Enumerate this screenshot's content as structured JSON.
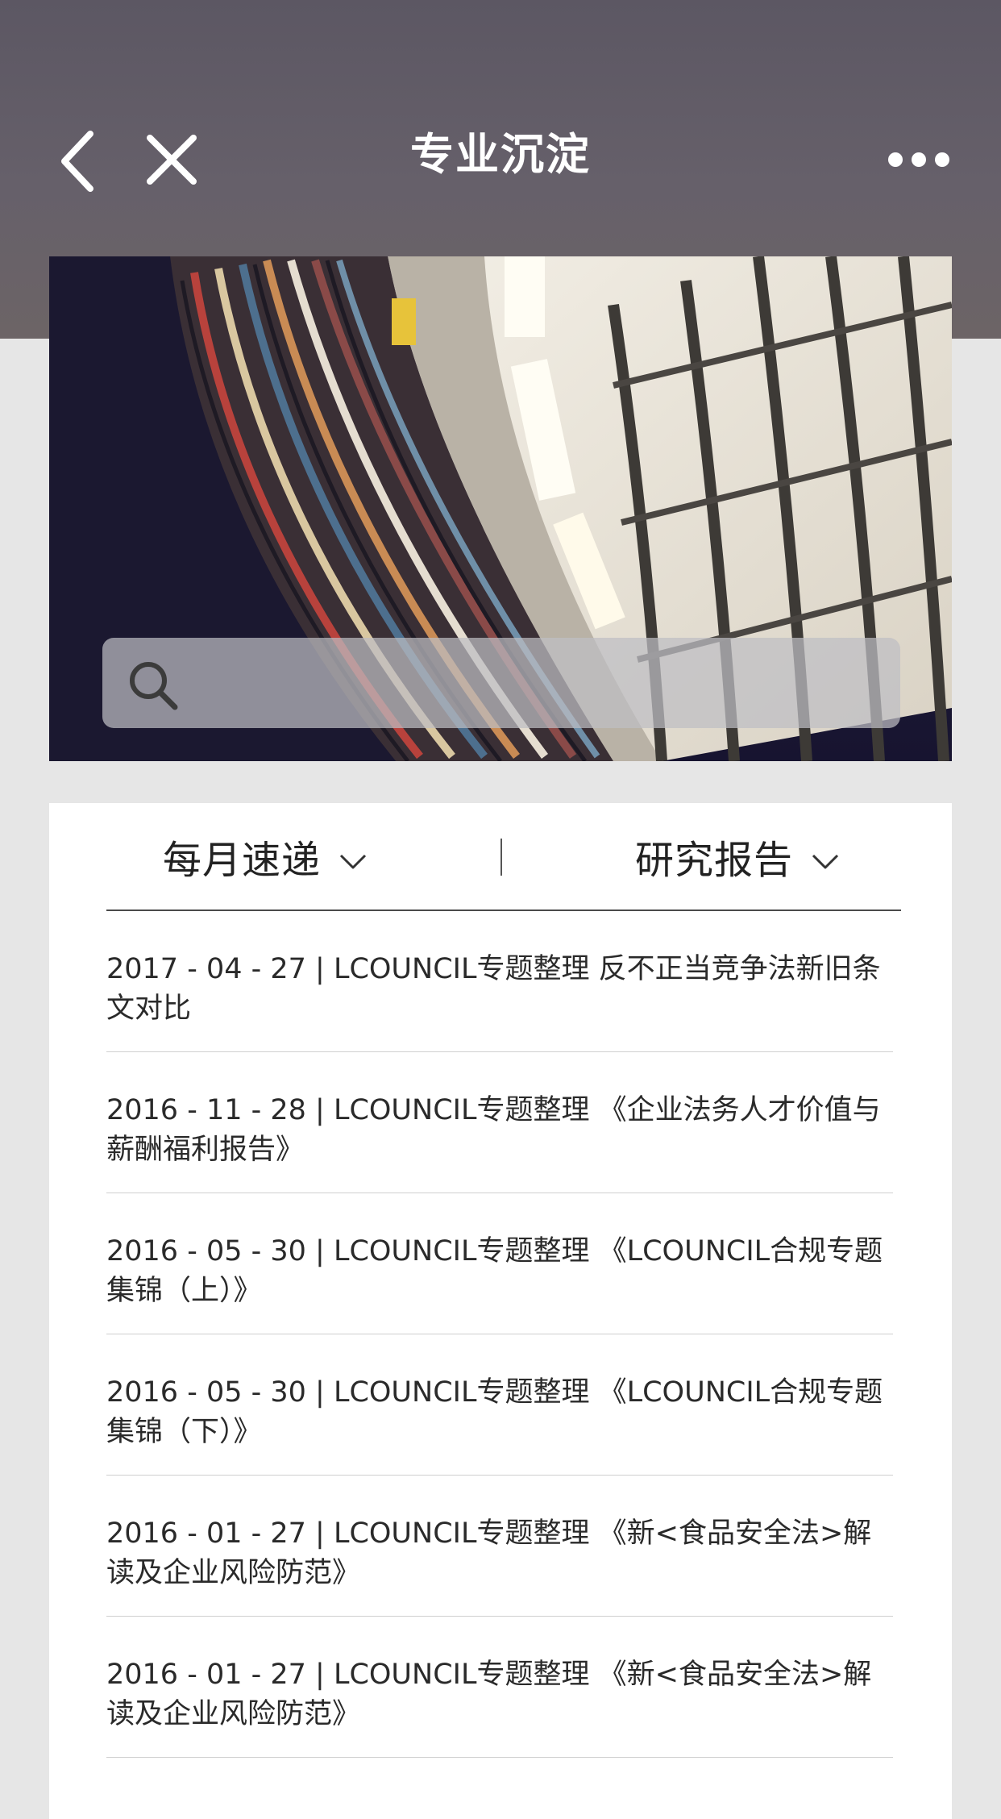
{
  "nav": {
    "title": "专业沉淀",
    "back_icon": "chevron-left-icon",
    "close_icon": "close-icon",
    "more_icon": "more-dots-icon"
  },
  "banner": {
    "image": "library-bookshelves-photo"
  },
  "search": {
    "placeholder": "",
    "value": "",
    "icon": "search-icon"
  },
  "filters": {
    "monthly_label": "每月速递",
    "research_label": "研究报告"
  },
  "articles": [
    {
      "text": "2017 - 04 - 27 | LCOUNCIL专题整理 反不正当竞争法新旧条文对比"
    },
    {
      "text": "2016 - 11 - 28 | LCOUNCIL专题整理 《企业法务人才价值与薪酬福利报告》"
    },
    {
      "text": "2016 - 05 - 30 | LCOUNCIL专题整理 《LCOUNCIL合规专题集锦（上）》"
    },
    {
      "text": "2016 - 05 - 30 | LCOUNCIL专题整理 《LCOUNCIL合规专题集锦（下）》"
    },
    {
      "text": "2016 - 01 - 27 | LCOUNCIL专题整理 《新<食品安全法>解读及企业风险防范》"
    },
    {
      "text": "2016 - 01 - 27 | LCOUNCIL专题整理 《新<食品安全法>解读及企业风险防范》"
    }
  ],
  "colors": {
    "header_bg": "#5c5763",
    "page_bg": "#e6e6e6",
    "card_bg": "#ffffff",
    "text": "#2a2a2a"
  }
}
